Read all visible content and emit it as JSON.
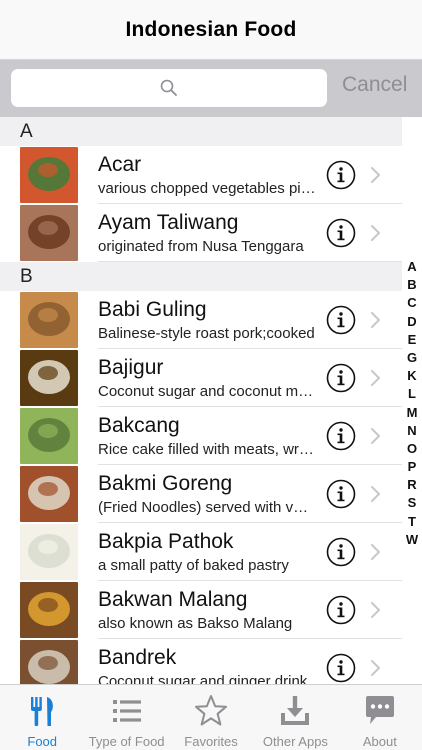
{
  "nav": {
    "title": "Indonesian Food"
  },
  "search": {
    "placeholder": "",
    "cancel_label": "Cancel"
  },
  "sections": [
    {
      "letter": "A",
      "items": [
        {
          "title": "Acar",
          "subtitle": "various chopped vegetables pickled in vinegar",
          "plate": "#3f7d3a",
          "hi": "#d2572e"
        },
        {
          "title": "Ayam Taliwang",
          "subtitle": "originated from Nusa Tenggara",
          "plate": "#6b3a20",
          "hi": "#a8745a"
        }
      ]
    },
    {
      "letter": "B",
      "items": [
        {
          "title": "Babi Guling",
          "subtitle": "Balinese-style roast pork;cooked",
          "plate": "#8a5a2e",
          "hi": "#c68a4a"
        },
        {
          "title": "Bajigur",
          "subtitle": "Coconut sugar and coconut milk drink",
          "plate": "#e8e2d0",
          "hi": "#5a3a10"
        },
        {
          "title": "Bakcang",
          "subtitle": "Rice cake filled with meats, wrapped",
          "plate": "#5a7a3a",
          "hi": "#8fb45a"
        },
        {
          "title": "Bakmi Goreng",
          "subtitle": "(Fried Noodles) served with vegetables",
          "plate": "#e0d8c8",
          "hi": "#a0502a"
        },
        {
          "title": "Bakpia Pathok",
          "subtitle": "a small patty of baked pastry",
          "plate": "#d8dccf",
          "hi": "#f4f2e8"
        },
        {
          "title": "Bakwan Malang",
          "subtitle": "also known as Bakso Malang",
          "plate": "#e2a530",
          "hi": "#7a4a22"
        },
        {
          "title": "Bandrek",
          "subtitle": "Coconut sugar and ginger drink",
          "plate": "#d8cfc0",
          "hi": "#7a5030"
        }
      ]
    }
  ],
  "index_letters": [
    "A",
    "B",
    "C",
    "D",
    "E",
    "G",
    "K",
    "L",
    "M",
    "N",
    "O",
    "P",
    "R",
    "S",
    "T",
    "W"
  ],
  "tabs": [
    {
      "label": "Food",
      "icon": "fork-knife-icon",
      "active": true
    },
    {
      "label": "Type of Food",
      "icon": "list-icon",
      "active": false
    },
    {
      "label": "Favorites",
      "icon": "star-icon",
      "active": false
    },
    {
      "label": "Other Apps",
      "icon": "download-icon",
      "active": false
    },
    {
      "label": "About",
      "icon": "chat-bubble-icon",
      "active": false
    }
  ],
  "colors": {
    "accent": "#1a7fd6",
    "inactive": "#8e8e93",
    "section_bg": "#f0f0f2",
    "search_bar_bg": "#c9c9ce"
  }
}
